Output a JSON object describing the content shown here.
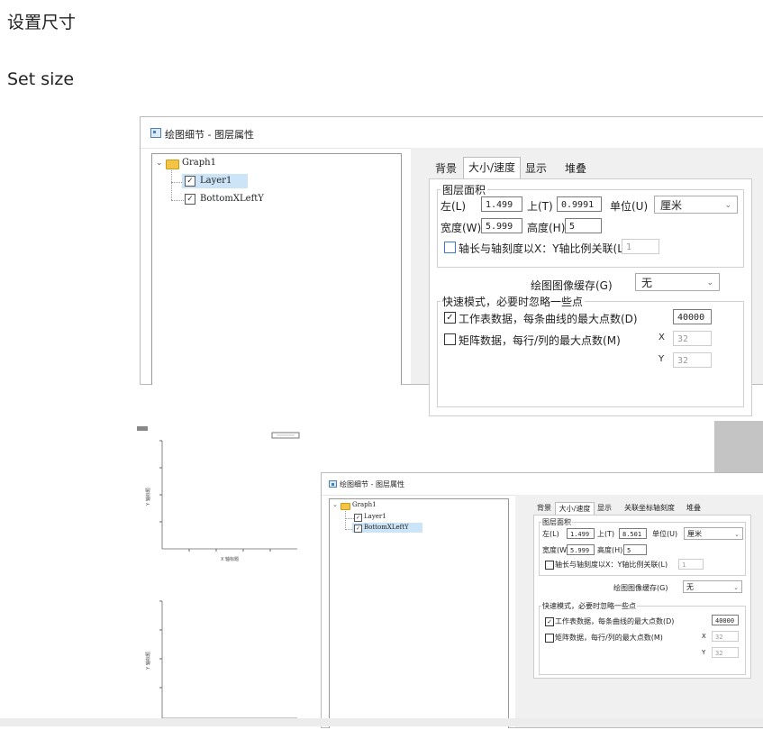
{
  "heading": {
    "title": "设置尺寸",
    "subtitle": "Set size"
  },
  "dialog1": {
    "title": "绘图细节 - 图层属性",
    "tree": {
      "root": "Graph1",
      "layer": "Layer1",
      "axis": "BottomXLeftY"
    },
    "tabs": [
      "背景",
      "大小/速度",
      "显示",
      "堆叠"
    ],
    "area_group": "图层面积",
    "left_label": "左(L)",
    "left_value": "1.499",
    "top_label": "上(T)",
    "top_value": "0.9991",
    "unit_label": "单位(U)",
    "unit_value": "厘米",
    "width_label": "宽度(W)",
    "width_value": "5.999",
    "height_label": "高度(H)",
    "height_value": "5",
    "link_label": "轴长与轴刻度以X：Y轴比例关联(L)",
    "link_value": "1",
    "cache_label": "绘图图像缓存(G)",
    "cache_value": "无",
    "fast_group": "快速模式，必要时忽略一些点",
    "worksheet_label": "工作表数据，每条曲线的最大点数(D)",
    "worksheet_value": "40000",
    "matrix_label": "矩阵数据，每行/列的最大点数(M)",
    "x_label": "X",
    "x_value": "32",
    "y_label": "Y",
    "y_value": "32"
  },
  "graph": {
    "ylabel": "Y 轴标题",
    "xlabel": "X 轴标题"
  },
  "dialog2": {
    "title": "绘图细节 - 图层属性",
    "tree": {
      "root": "Graph1",
      "layer": "Layer1",
      "axis": "BottomXLeftY"
    },
    "tabs": [
      "背景",
      "大小/速度",
      "显示",
      "关联坐标轴刻度",
      "堆叠"
    ],
    "area_group": "图层面积",
    "left_label": "左(L)",
    "left_value": "1.499",
    "top_label": "上(T)",
    "top_value": "8.501",
    "unit_label": "单位(U)",
    "unit_value": "厘米",
    "width_label": "宽度(W)",
    "width_value": "5.999",
    "height_label": "高度(H)",
    "height_value": "5",
    "link_label": "轴长与轴刻度以X：Y轴比例关联(L)",
    "link_value": "1",
    "cache_label": "绘图图像缓存(G)",
    "cache_value": "无",
    "fast_group": "快速模式，必要时忽略一些点",
    "worksheet_label": "工作表数据，每条曲线的最大点数(D)",
    "worksheet_value": "40000",
    "matrix_label": "矩阵数据，每行/列的最大点数(M)",
    "x_label": "X",
    "x_value": "32",
    "y_label": "Y",
    "y_value": "32"
  }
}
